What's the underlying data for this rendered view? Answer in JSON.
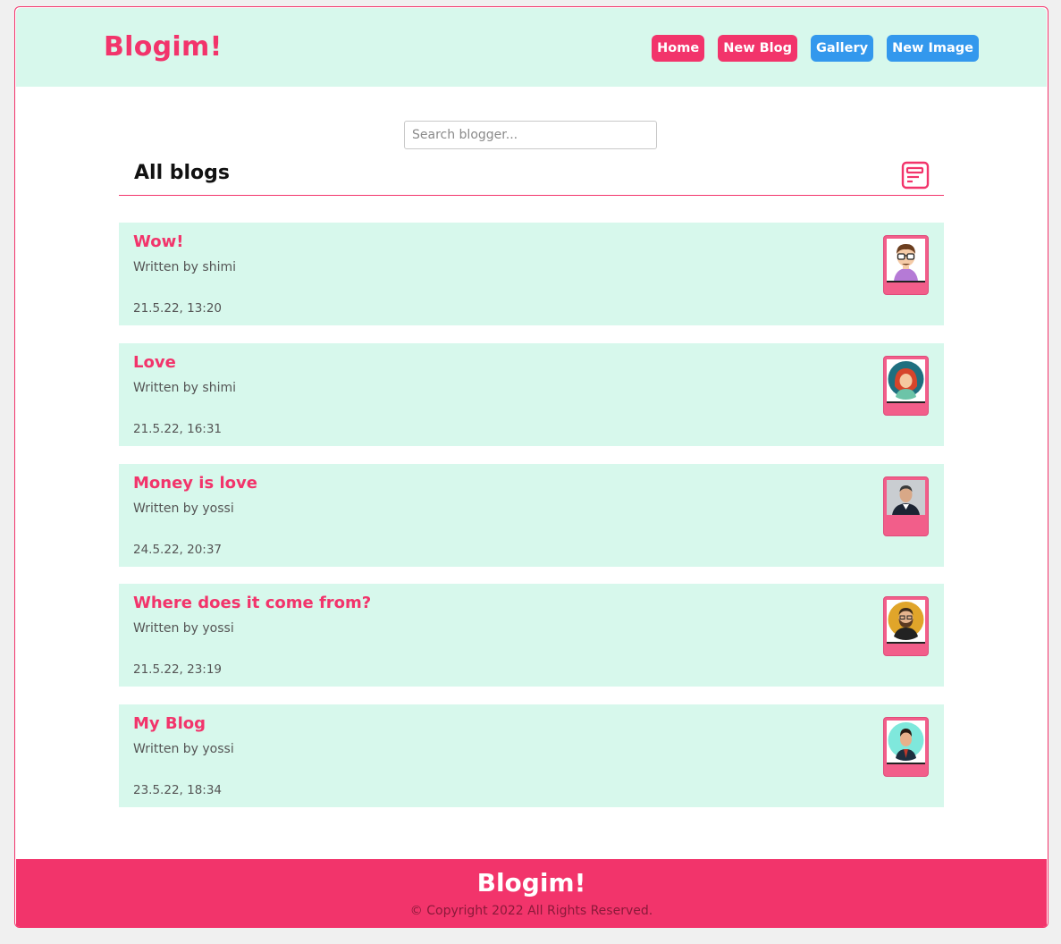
{
  "header": {
    "logo": "Blogim!",
    "nav": [
      "Home",
      "New Blog",
      "Gallery",
      "New Image"
    ]
  },
  "search": {
    "placeholder": "Search blogger..."
  },
  "section": {
    "title": "All blogs",
    "icon": "blog-post-icon"
  },
  "blogs": [
    {
      "title": "Wow!",
      "author": "Written by shimi",
      "date": "21.5.22, 13:20",
      "avatar": "glasses-man-avatar"
    },
    {
      "title": "Love",
      "author": "Written by shimi",
      "date": "21.5.22, 16:31",
      "avatar": "red-hair-woman-avatar"
    },
    {
      "title": "Money is love",
      "author": "Written by yossi",
      "date": "24.5.22, 20:37",
      "avatar": "businessman-photo-avatar"
    },
    {
      "title": "Where does it come from?",
      "author": "Written by yossi",
      "date": "21.5.22, 23:19",
      "avatar": "bearded-man-avatar"
    },
    {
      "title": "My Blog",
      "author": "Written by yossi",
      "date": "23.5.22, 18:34",
      "avatar": "young-man-avatar"
    }
  ],
  "footer": {
    "logo": "Blogim!",
    "copyright": "© Copyright 2022 All Rights Reserved."
  },
  "colors": {
    "accent": "#f2346b",
    "mint": "#d7f8ec",
    "blue": "#3398ed"
  }
}
